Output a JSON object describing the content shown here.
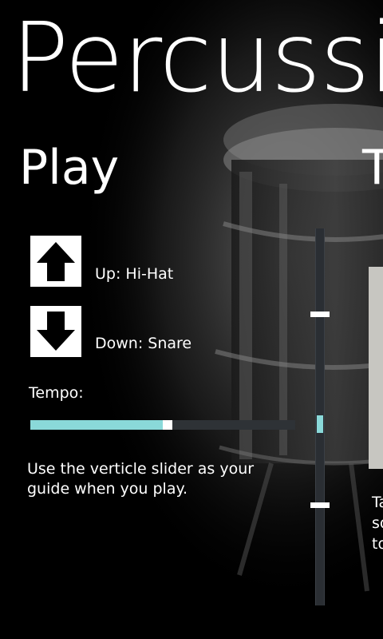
{
  "app": {
    "title": "Percussion"
  },
  "pivot": {
    "current": "Play",
    "next": "T"
  },
  "controls": {
    "up": {
      "icon": "arrow-up-icon",
      "label": "Up: Hi-Hat"
    },
    "down": {
      "icon": "arrow-down-icon",
      "label": "Down: Snare"
    }
  },
  "tempo": {
    "label": "Tempo:",
    "value_fraction": 0.5
  },
  "guide": {
    "text": "Use the verticle slider as your guide when you play."
  },
  "next_panel": {
    "text_lines": [
      "Ta",
      "so",
      "to"
    ]
  },
  "colors": {
    "accent": "#8ad9d9",
    "background": "#000000",
    "text": "#ffffff",
    "track": "#2e3236"
  }
}
